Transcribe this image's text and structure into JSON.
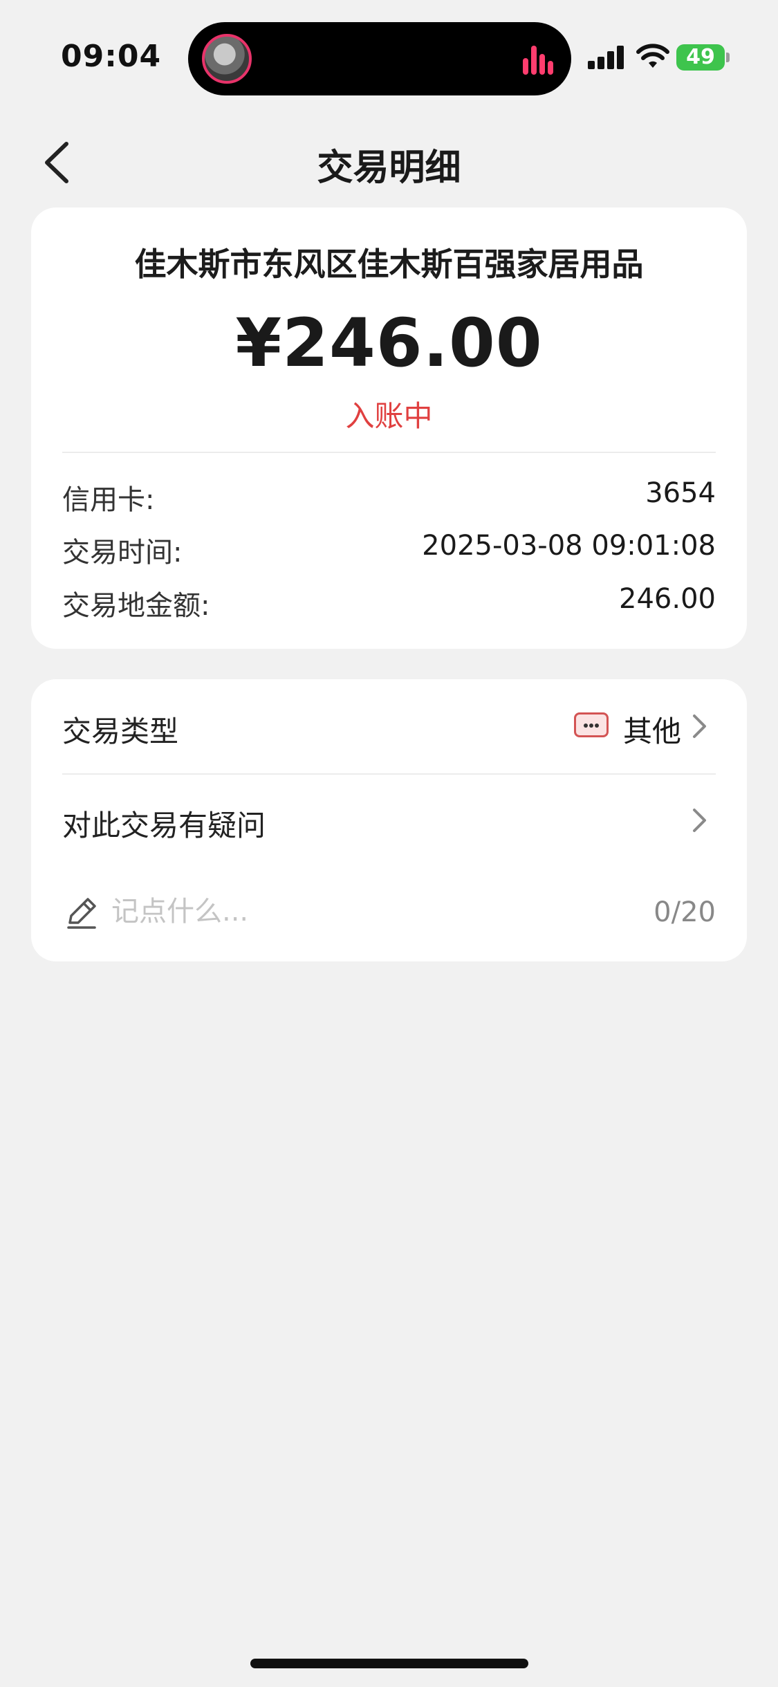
{
  "status_bar": {
    "time": "09:04",
    "battery": "49",
    "icons": [
      "live-activity-avatar-icon",
      "audio-levels-icon",
      "cellular-signal-icon",
      "wifi-icon",
      "battery-charging-icon"
    ]
  },
  "nav": {
    "title": "交易明细",
    "back_icon": "chevron-left-icon"
  },
  "summary": {
    "merchant": "佳木斯市东风区佳木斯百强家居用品",
    "amount": "¥246.00",
    "status": "入账中",
    "status_color": "#e04040"
  },
  "details": [
    {
      "label": "信用卡:",
      "value": "3654"
    },
    {
      "label": "交易时间:",
      "value": "2025-03-08 09:01:08"
    },
    {
      "label": "交易地金额:",
      "value": "246.00"
    }
  ],
  "more": {
    "type_label": "交易类型",
    "type_value": "其他",
    "type_icon": "more-dots-badge-icon",
    "question_label": "对此交易有疑问",
    "note_icon": "pencil-icon",
    "note_placeholder": "记点什么...",
    "note_value": "",
    "note_count": "0/20"
  },
  "colors": {
    "background": "#f1f1f1",
    "card": "#ffffff",
    "accent_red": "#e04040",
    "battery_green": "#3ec44d"
  }
}
